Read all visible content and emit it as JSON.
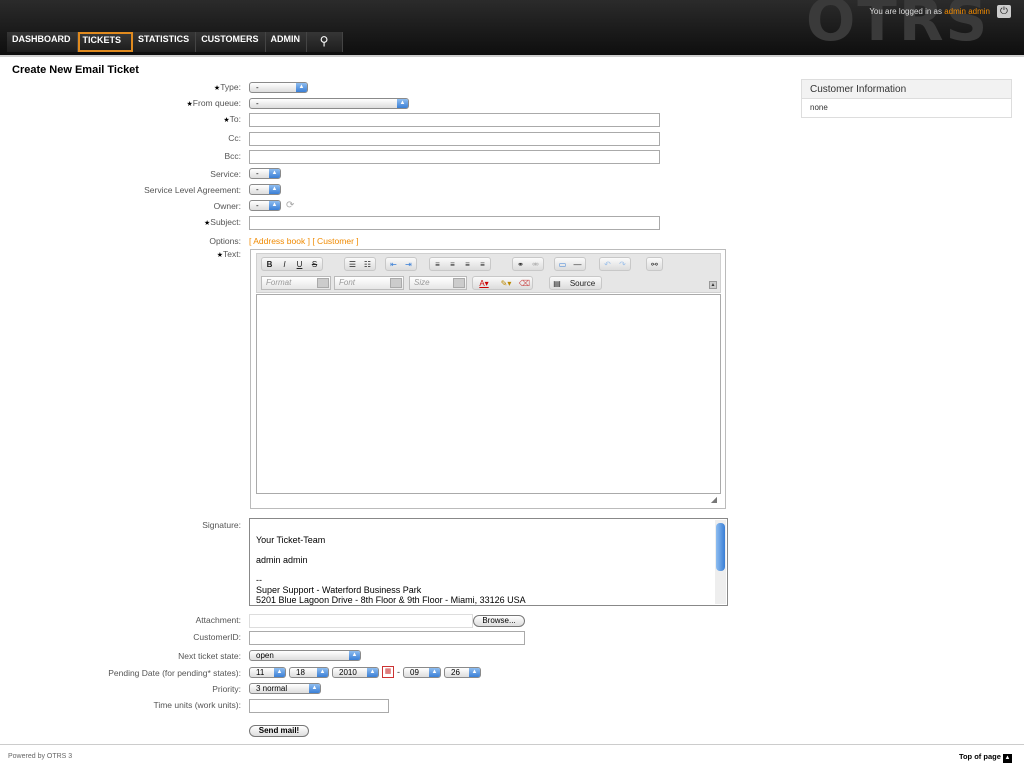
{
  "header": {
    "logo": "OTRS",
    "login_prefix": "You are logged in as ",
    "login_user": "admin admin"
  },
  "nav": {
    "items": [
      {
        "label": "DASHBOARD"
      },
      {
        "label": "TICKETS"
      },
      {
        "label": "STATISTICS"
      },
      {
        "label": "CUSTOMERS"
      },
      {
        "label": "ADMIN"
      }
    ]
  },
  "page": {
    "title": "Create New Email Ticket"
  },
  "form": {
    "type_label": "Type:",
    "type_value": "-",
    "queue_label": "From queue:",
    "queue_value": "-",
    "to_label": "To:",
    "cc_label": "Cc:",
    "bcc_label": "Bcc:",
    "service_label": "Service:",
    "service_value": "-",
    "sla_label": "Service Level Agreement:",
    "sla_value": "-",
    "owner_label": "Owner:",
    "owner_value": "-",
    "subject_label": "Subject:",
    "options_label": "Options:",
    "options_address": "[ Address book ]",
    "options_customer": "[ Customer ]",
    "text_label": "Text:",
    "signature_label": "Signature:",
    "attachment_label": "Attachment:",
    "browse_label": "Browse...",
    "customerid_label": "CustomerID:",
    "next_state_label": "Next ticket state:",
    "next_state_value": "open",
    "pending_label": "Pending Date (for pending* states):",
    "pending_month": "11",
    "pending_day": "18",
    "pending_year": "2010",
    "pending_dash": "-",
    "pending_hour": "09",
    "pending_minute": "26",
    "priority_label": "Priority:",
    "priority_value": "3 normal",
    "time_units_label": "Time units (work units):",
    "send_label": "Send mail!"
  },
  "editor": {
    "format_placeholder": "Format",
    "font_placeholder": "Font",
    "size_placeholder": "Size",
    "source_label": "Source"
  },
  "signature": {
    "line1": "Your Ticket-Team",
    "line2": "admin admin",
    "line3": "--",
    "line4": "Super Support - Waterford Business Park",
    "line5": "5201 Blue Lagoon Drive - 8th Floor & 9th Floor - Miami, 33126 USA"
  },
  "customer_info": {
    "title": "Customer Information",
    "value": "none"
  },
  "footer": {
    "powered": "Powered by OTRS 3",
    "top": "Top of page"
  }
}
